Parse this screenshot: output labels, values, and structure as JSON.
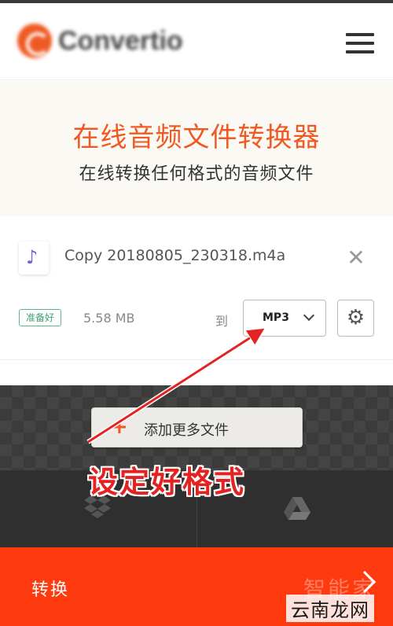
{
  "header": {
    "logo_text": "Convertio",
    "menu_icon": "hamburger-menu-icon"
  },
  "hero": {
    "title": "在线音频文件转换器",
    "subtitle": "在线转换任何格式的音频文件"
  },
  "file": {
    "icon": "music-note-icon",
    "name": "Copy 20180805_230318.m4a",
    "status": "准备好",
    "size": "5.58 MB",
    "to_label": "到",
    "format": "MP3",
    "close_icon": "close-icon",
    "settings_icon": "gear-icon"
  },
  "add_files": {
    "label": "添加更多文件",
    "icon": "plus-icon"
  },
  "cloud": {
    "dropbox_icon": "dropbox-icon",
    "drive_icon": "google-drive-icon"
  },
  "convert": {
    "label": "转换",
    "icon": "chevron-right-icon"
  },
  "annotation": {
    "text": "设定好格式"
  },
  "watermark": {
    "top": "智能家",
    "bottom": "云南龙网"
  },
  "colors": {
    "brand_orange": "#ef5a24",
    "convert_bar": "#ff3a0f",
    "ready_green": "#3fa275",
    "annotation_red": "#e52222"
  }
}
